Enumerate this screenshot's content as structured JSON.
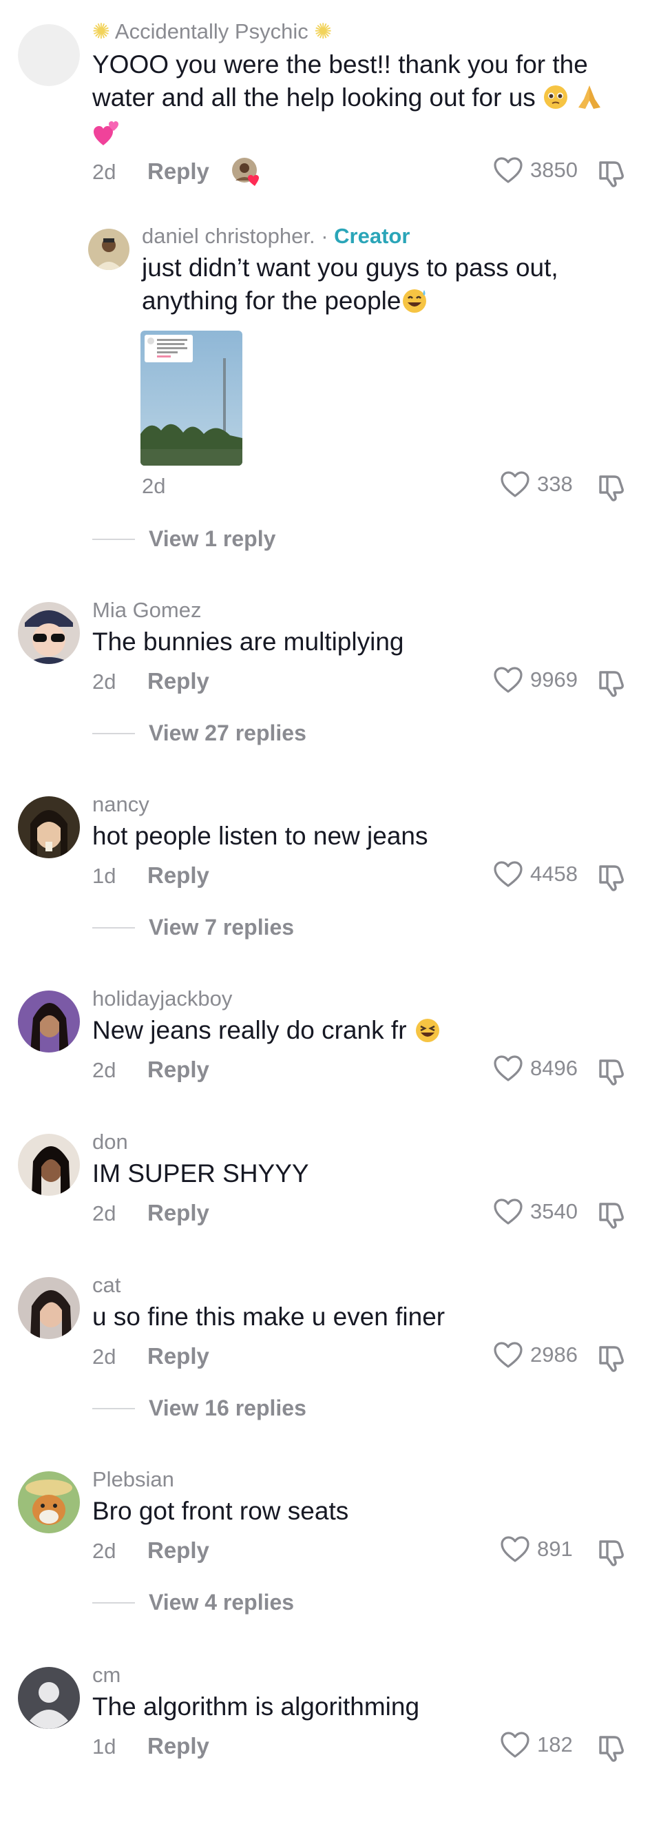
{
  "colors": {
    "text": "#161823",
    "muted": "#8a8b91",
    "creator": "#2aa5b8",
    "background": "#ffffff"
  },
  "comments": [
    {
      "username": "Accidentally Psychic",
      "text": "YOOO you were the best!! thank you for the water and all the help looking out for us",
      "time": "2d",
      "reply": "Reply",
      "likes": "3850",
      "reply_thread": {
        "username": "daniel christopher.",
        "separator": " · ",
        "creator_badge": "Creator",
        "text_line1": "just didn’t want you guys to pass out,",
        "text_line2": "anything for the people",
        "thumb_text": "YOOO you were the best!! thank you for the water and all the help looking out for us",
        "time": "2d",
        "likes": "338"
      },
      "view_replies": "View 1 reply"
    },
    {
      "username": "Mia Gomez",
      "text": "The bunnies are multiplying",
      "time": "2d",
      "reply": "Reply",
      "likes": "9969",
      "view_replies": "View 27 replies"
    },
    {
      "username": "nancy",
      "text": "hot people listen to new jeans",
      "time": "1d",
      "reply": "Reply",
      "likes": "4458",
      "view_replies": "View 7 replies"
    },
    {
      "username": "holidayjackboy",
      "text": "New jeans really do crank fr",
      "time": "2d",
      "reply": "Reply",
      "likes": "8496"
    },
    {
      "username": "don",
      "text": "IM SUPER SHYYY",
      "time": "2d",
      "reply": "Reply",
      "likes": "3540"
    },
    {
      "username": "cat",
      "text": "u so fine this make u even finer",
      "time": "2d",
      "reply": "Reply",
      "likes": "2986",
      "view_replies": "View 16 replies"
    },
    {
      "username": "Plebsian",
      "text": "Bro got front row seats",
      "time": "2d",
      "reply": "Reply",
      "likes": "891",
      "view_replies": "View 4 replies"
    },
    {
      "username": "cm",
      "text": "The algorithm is algorithming",
      "time": "1d",
      "reply": "Reply",
      "likes": "182"
    }
  ]
}
